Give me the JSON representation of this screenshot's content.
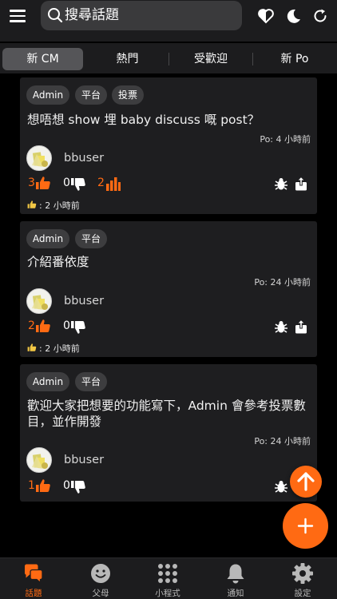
{
  "header": {
    "search_placeholder": "搜尋話題"
  },
  "tabs": [
    {
      "label": "新 CM"
    },
    {
      "label": "熱門"
    },
    {
      "label": "受歡迎"
    },
    {
      "label": "新 Po"
    }
  ],
  "posts": [
    {
      "tags": [
        "Admin",
        "平台",
        "投票"
      ],
      "title": "想唔想 show 埋 baby discuss 嘅 post？",
      "time": "Po: 4 小時前",
      "user": "bbuser",
      "likes": "3",
      "dislikes": "0",
      "votes": "2",
      "liked_time": ": 2 小時前"
    },
    {
      "tags": [
        "Admin",
        "平台"
      ],
      "title": "介紹番依度",
      "time": "Po: 24 小時前",
      "user": "bbuser",
      "likes": "2",
      "dislikes": "0",
      "liked_time": ": 2 小時前"
    },
    {
      "tags": [
        "Admin",
        "平台"
      ],
      "title": "歡迎大家把想要的功能寫下，Admin 會參考投票數目，並作開發",
      "time": "Po: 24 小時前",
      "user": "bbuser",
      "likes": "1",
      "dislikes": "0"
    }
  ],
  "bottom_nav": [
    {
      "label": "話題",
      "icon": "chat-bubbles-icon"
    },
    {
      "label": "父母",
      "icon": "smiley-face-icon"
    },
    {
      "label": "小程式",
      "icon": "grid-dots-icon"
    },
    {
      "label": "通知",
      "icon": "bell-icon"
    },
    {
      "label": "設定",
      "icon": "gear-icon"
    }
  ],
  "colors": {
    "accent": "#ff6a13",
    "background": "#000000",
    "card": "#1e1e20",
    "bar": "#1c1c1e"
  }
}
